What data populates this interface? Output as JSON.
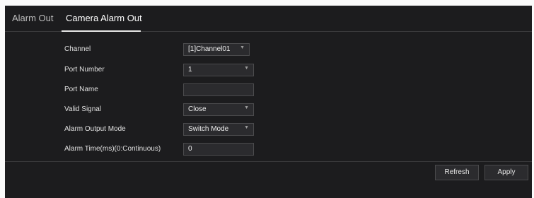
{
  "tabs": [
    {
      "label": "Alarm Out"
    },
    {
      "label": "Camera Alarm Out"
    }
  ],
  "form": {
    "channel": {
      "label": "Channel",
      "value": "[1]Channel01"
    },
    "port_number": {
      "label": "Port Number",
      "value": "1"
    },
    "port_name": {
      "label": "Port Name",
      "value": ""
    },
    "valid_signal": {
      "label": "Valid Signal",
      "value": "Close"
    },
    "alarm_output_mode": {
      "label": "Alarm Output Mode",
      "value": "Switch Mode"
    },
    "alarm_time": {
      "label": "Alarm Time(ms)(0:Continuous)",
      "value": "0"
    }
  },
  "buttons": {
    "refresh": "Refresh",
    "apply": "Apply"
  },
  "icons": {
    "dropdown": "chevron-down-icon"
  },
  "colors": {
    "panel_bg": "#1c1c1e",
    "control_bg": "#2b2b2e"
  }
}
